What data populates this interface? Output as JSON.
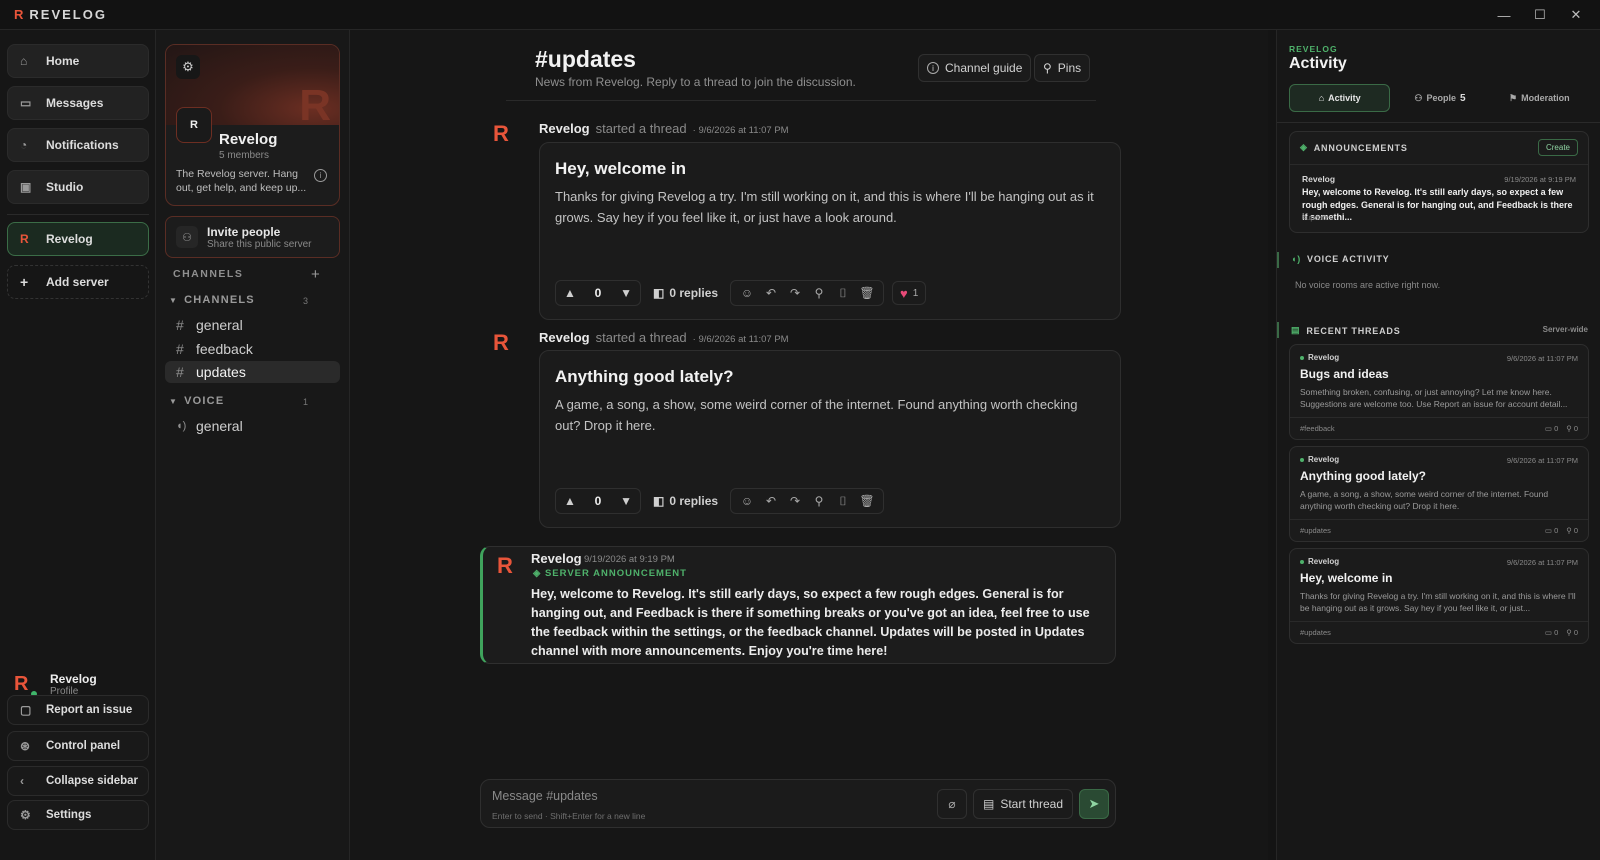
{
  "app": {
    "brand_letter": "R",
    "brand_name": "REVELOG"
  },
  "window_controls": {
    "minimize": "—",
    "maximize": "☐",
    "close": "✕"
  },
  "nav": {
    "items": [
      {
        "label": "Home",
        "icon": "home-icon"
      },
      {
        "label": "Messages",
        "icon": "messages-icon"
      },
      {
        "label": "Notifications",
        "icon": "bell-icon"
      },
      {
        "label": "Studio",
        "icon": "studio-icon"
      }
    ],
    "server": {
      "letter": "R",
      "label": "Revelog"
    },
    "add_server": "Add server",
    "profile": {
      "name": "Revelog",
      "sub": "Profile"
    },
    "bottom": [
      {
        "label": "Report an issue",
        "icon": "report-icon"
      },
      {
        "label": "Control panel",
        "icon": "control-panel-icon"
      },
      {
        "label": "Collapse sidebar",
        "icon": "chevron-left-icon"
      },
      {
        "label": "Settings",
        "icon": "gear-icon"
      }
    ]
  },
  "server_card": {
    "avatar_letter": "R",
    "banner_letter": "R",
    "name": "Revelog",
    "members": "5 members",
    "description": "The Revelog server. Hang out, get help, and keep up...",
    "invite_title": "Invite people",
    "invite_sub": "Share this public server"
  },
  "channels": {
    "section_label": "CHANNELS",
    "text_group": {
      "label": "CHANNELS",
      "count": "3",
      "items": [
        "general",
        "feedback",
        "updates"
      ],
      "selected": "updates"
    },
    "voice_group": {
      "label": "VOICE",
      "count": "1",
      "items": [
        "general"
      ]
    }
  },
  "channel_header": {
    "title": "#updates",
    "subtitle": "News from Revelog. Reply to a thread to join the discussion.",
    "guide_button": "Channel guide",
    "pins_button": "Pins"
  },
  "posts": [
    {
      "author": "Revelog",
      "verb": "started a thread",
      "timestamp": "· 9/6/2026 at 11:07 PM",
      "title": "Hey, welcome in",
      "body": "Thanks for giving Revelog a try. I'm still working on it, and this is where I'll be hanging out as it grows. Say hey if you feel like it, or just have a look around.",
      "votes": "0",
      "replies": "0 replies",
      "reaction_count": "1"
    },
    {
      "author": "Revelog",
      "verb": "started a thread",
      "timestamp": "· 9/6/2026 at 11:07 PM",
      "title": "Anything good lately?",
      "body": "A game, a song, a show, some weird corner of the internet. Found anything worth checking out? Drop it here.",
      "votes": "0",
      "replies": "0 replies"
    }
  ],
  "announcement": {
    "author": "Revelog",
    "timestamp": "9/19/2026 at 9:19 PM",
    "tag": "SERVER ANNOUNCEMENT",
    "body": "Hey, welcome to Revelog. It's still early days, so expect a few rough edges. General is for hanging out, and Feedback is there if something breaks or you've got an idea, feel free to use the feedback within the settings, or the feedback channel. Updates will be posted in Updates channel with more announcements. Enjoy you're time here!"
  },
  "composer": {
    "placeholder": "Message #updates",
    "hint": "Enter to send · Shift+Enter for a new line",
    "start_thread": "Start thread"
  },
  "activity_panel": {
    "brand": "REVELOG",
    "title": "Activity",
    "tabs": [
      {
        "label": "Activity",
        "count": ""
      },
      {
        "label": "People",
        "count": "5"
      },
      {
        "label": "Moderation",
        "count": ""
      }
    ],
    "announcements": {
      "heading": "ANNOUNCEMENTS",
      "create": "Create",
      "author": "Revelog",
      "timestamp": "9/19/2026 at 9:19 PM",
      "body": "Hey, welcome to Revelog. It's still early days, so expect a few rough edges. General is for hanging out, and Feedback is there if somethi...",
      "channel": "#updates"
    },
    "voice": {
      "heading": "VOICE ACTIVITY",
      "empty": "No voice rooms are active right now."
    },
    "recent": {
      "heading": "RECENT THREADS",
      "scope": "Server-wide",
      "threads": [
        {
          "author": "Revelog",
          "timestamp": "9/6/2026 at 11:07 PM",
          "title": "Bugs and ideas",
          "body": "Something broken, confusing, or just annoying? Let me know here. Suggestions are welcome too. Use Report an issue for account detail...",
          "channel": "#feedback",
          "replies": "0",
          "pins": "0"
        },
        {
          "author": "Revelog",
          "timestamp": "9/6/2026 at 11:07 PM",
          "title": "Anything good lately?",
          "body": "A game, a song, a show, some weird corner of the internet. Found anything worth checking out? Drop it here.",
          "channel": "#updates",
          "replies": "0",
          "pins": "0"
        },
        {
          "author": "Revelog",
          "timestamp": "9/6/2026 at 11:07 PM",
          "title": "Hey, welcome in",
          "body": "Thanks for giving Revelog a try. I'm still working on it, and this is where I'll be hanging out as it grows. Say hey if you feel like it, or just...",
          "channel": "#updates",
          "replies": "0",
          "pins": "0"
        }
      ]
    }
  },
  "colors": {
    "accent_orange": "#e8553a",
    "accent_green": "#4fb26b",
    "heart": "#e84a78",
    "background": "#161616"
  }
}
